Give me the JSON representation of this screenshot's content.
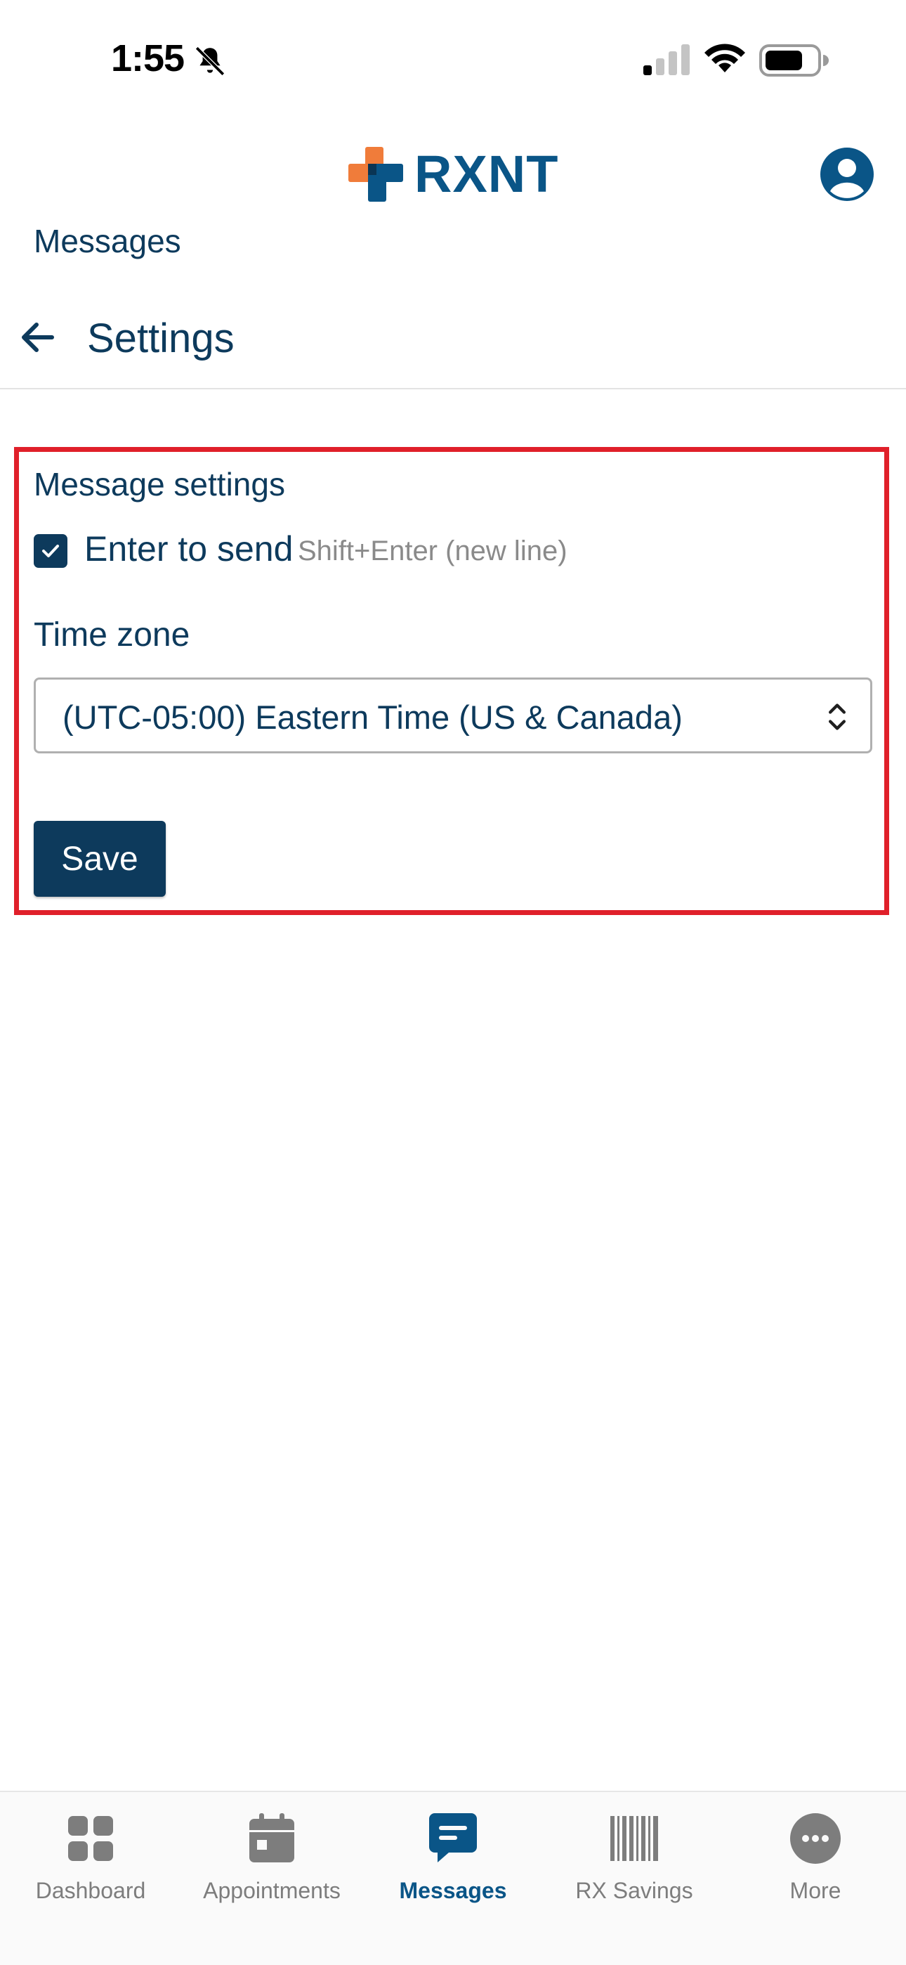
{
  "status_bar": {
    "time": "1:55",
    "icons": [
      "bell-slash-icon",
      "cellular-signal-icon",
      "wifi-icon",
      "battery-icon"
    ]
  },
  "header": {
    "logo_text": "RXNT",
    "breadcrumb": "Messages",
    "page_title": "Settings",
    "icons": [
      "back-arrow-icon",
      "user-avatar-icon"
    ]
  },
  "settings": {
    "section_title": "Message settings",
    "enter_to_send": {
      "label": "Enter to send",
      "hint": "Shift+Enter (new line)",
      "checked": true
    },
    "time_zone": {
      "label": "Time zone",
      "selected": "(UTC-05:00) Eastern Time (US & Canada)"
    },
    "save_label": "Save"
  },
  "tab_bar": {
    "tabs": [
      {
        "label": "Dashboard",
        "icon": "dashboard-grid-icon",
        "active": false
      },
      {
        "label": "Appointments",
        "icon": "calendar-icon",
        "active": false
      },
      {
        "label": "Messages",
        "icon": "message-bubble-icon",
        "active": true
      },
      {
        "label": "RX Savings",
        "icon": "barcode-icon",
        "active": false
      },
      {
        "label": "More",
        "icon": "more-dots-icon",
        "active": false
      }
    ]
  },
  "colors": {
    "primary": "#0d3a5c",
    "brand_blue": "#0a5587",
    "brand_orange": "#f07c3a",
    "highlight_red": "#e0202a",
    "inactive_gray": "#7d7d7d"
  }
}
